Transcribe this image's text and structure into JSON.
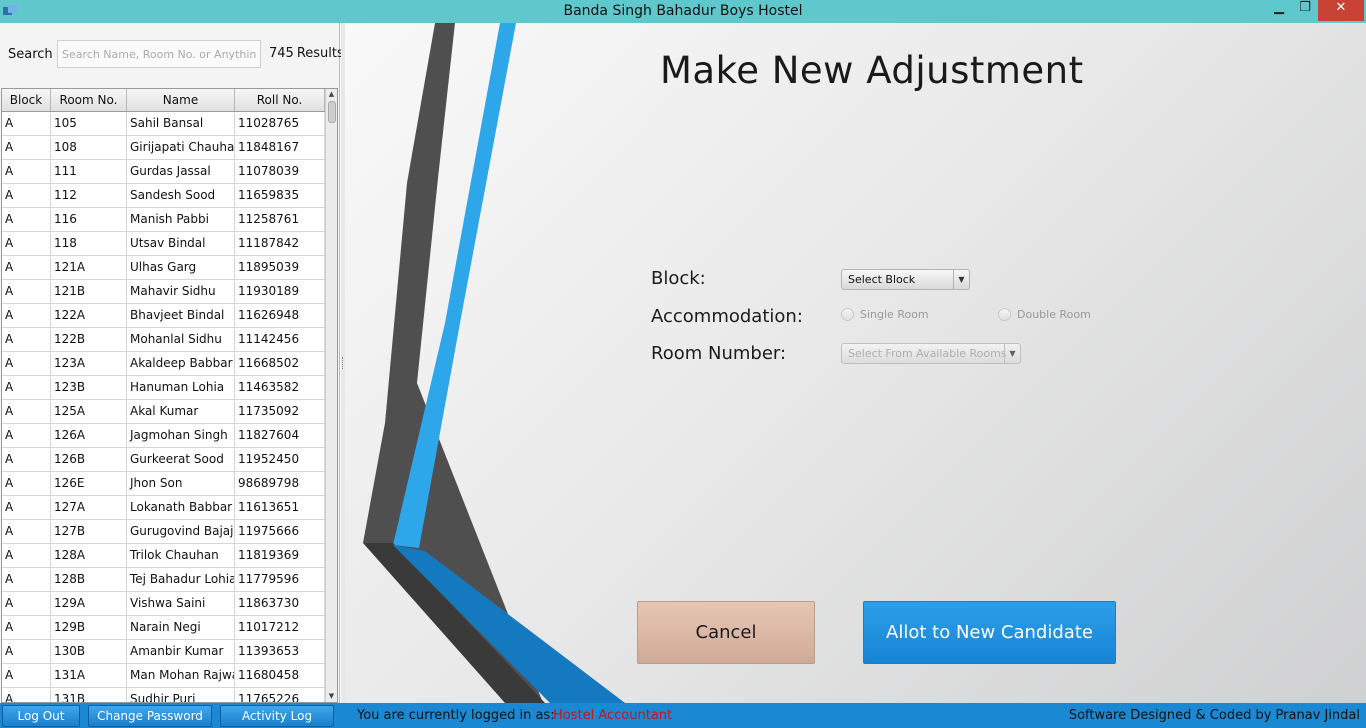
{
  "window": {
    "title": "Banda Singh Bahadur Boys Hostel",
    "controls": {
      "minimize": "▁",
      "maximize": "❐",
      "close": "✕"
    }
  },
  "search": {
    "label": "Search",
    "placeholder": "Search Name, Room No. or Anything",
    "value": "",
    "result_count": "745",
    "result_unit": "Results"
  },
  "table": {
    "columns": [
      "Block",
      "Room No.",
      "Name",
      "Roll No."
    ],
    "rows": [
      [
        "A",
        "105",
        "Sahil Bansal",
        "11028765"
      ],
      [
        "A",
        "108",
        "Girijapati Chauhan",
        "11848167"
      ],
      [
        "A",
        "111",
        "Gurdas Jassal",
        "11078039"
      ],
      [
        "A",
        "112",
        "Sandesh Sood",
        "11659835"
      ],
      [
        "A",
        "116",
        "Manish Pabbi",
        "11258761"
      ],
      [
        "A",
        "118",
        "Utsav Bindal",
        "11187842"
      ],
      [
        "A",
        "121A",
        "Ulhas Garg",
        "11895039"
      ],
      [
        "A",
        "121B",
        "Mahavir Sidhu",
        "11930189"
      ],
      [
        "A",
        "122A",
        "Bhavjeet Bindal",
        "11626948"
      ],
      [
        "A",
        "122B",
        "Mohanlal Sidhu",
        "11142456"
      ],
      [
        "A",
        "123A",
        "Akaldeep Babbar",
        "11668502"
      ],
      [
        "A",
        "123B",
        "Hanuman Lohia",
        "11463582"
      ],
      [
        "A",
        "125A",
        "Akal Kumar",
        "11735092"
      ],
      [
        "A",
        "126A",
        "Jagmohan Singh",
        "11827604"
      ],
      [
        "A",
        "126B",
        "Gurkeerat Sood",
        "11952450"
      ],
      [
        "A",
        "126E",
        "Jhon Son",
        "98689798"
      ],
      [
        "A",
        "127A",
        "Lokanath Babbar",
        "11613651"
      ],
      [
        "A",
        "127B",
        "Gurugovind Bajaj",
        "11975666"
      ],
      [
        "A",
        "128A",
        "Trilok Chauhan",
        "11819369"
      ],
      [
        "A",
        "128B",
        "Tej Bahadur Lohia",
        "11779596"
      ],
      [
        "A",
        "129A",
        "Vishwa Saini",
        "11863730"
      ],
      [
        "A",
        "129B",
        "Narain Negi",
        "11017212"
      ],
      [
        "A",
        "130B",
        "Amanbir Kumar",
        "11393653"
      ],
      [
        "A",
        "131A",
        "Man Mohan Rajwal",
        "11680458"
      ],
      [
        "A",
        "131B",
        "Sudhir Puri",
        "11765226"
      ]
    ]
  },
  "form": {
    "heading": "Make New Adjustment",
    "block_label": "Block:",
    "block_select": "Select Block",
    "accommodation_label": "Accommodation:",
    "single_room": "Single Room",
    "double_room": "Double Room",
    "room_number_label": "Room Number:",
    "room_select": "Select From Available Rooms",
    "cancel_label": "Cancel",
    "allot_label": "Allot to New Candidate"
  },
  "statusbar": {
    "logout_label": "Log Out",
    "change_password_label": "Change Password",
    "activity_log_label": "Activity Log",
    "logged_in_text": "You are currently logged in as:",
    "role": "Hostel Accountant",
    "credit": "Software Designed & Coded by Pranav Jindal"
  },
  "colors": {
    "titlebar": "#5ec8cc",
    "statusbar": "#1b88d4",
    "accent_blue": "#2aa3e6",
    "role_red": "#c4141b"
  }
}
